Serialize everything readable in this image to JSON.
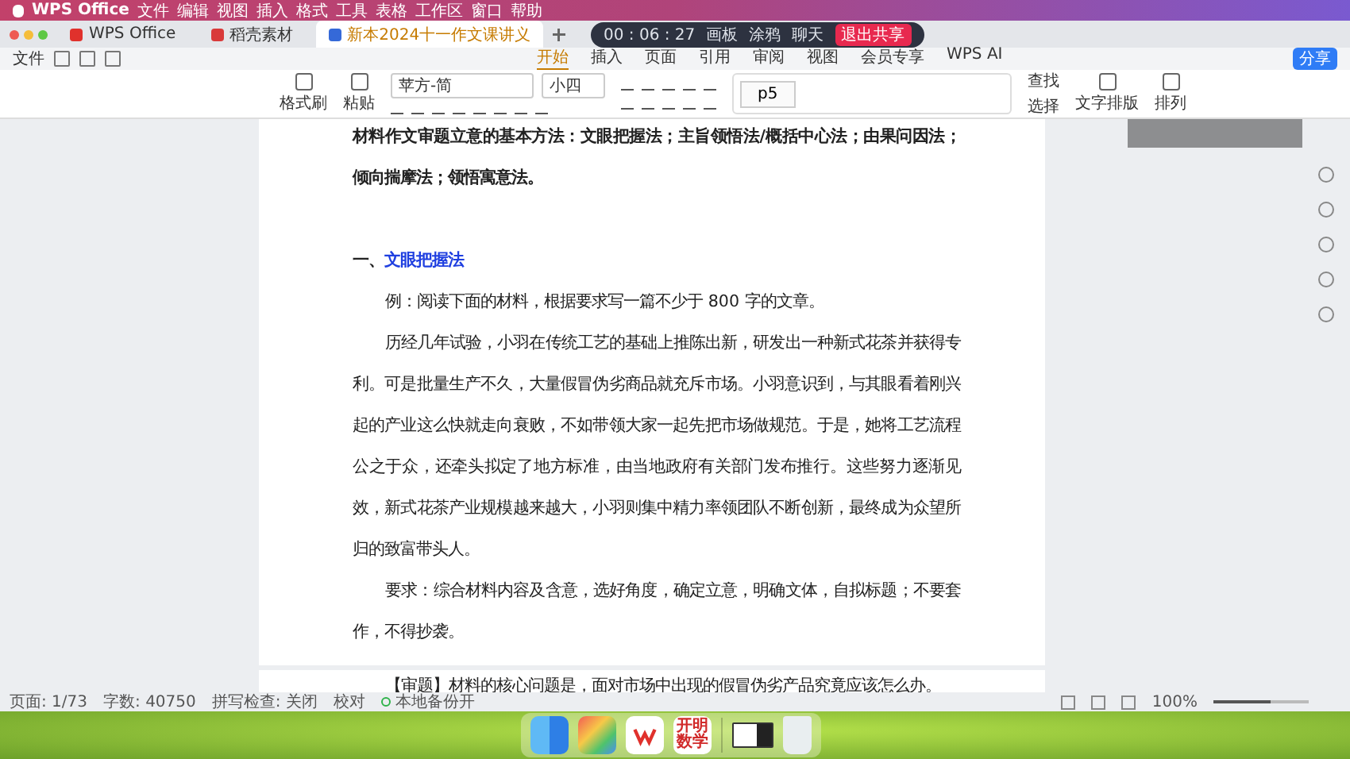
{
  "menu_bar": {
    "app": "WPS Office",
    "items": [
      "文件",
      "编辑",
      "视图",
      "插入",
      "格式",
      "工具",
      "表格",
      "工作区",
      "窗口",
      "帮助"
    ]
  },
  "tabs": [
    {
      "label": "WPS Office",
      "kind": "home",
      "selected": false
    },
    {
      "label": "稻壳素材",
      "kind": "docer",
      "selected": false
    },
    {
      "label": "新本2024十一作文课讲义",
      "kind": "document",
      "selected": true
    }
  ],
  "recording_bar": {
    "timer": "00 : 06 : 27",
    "buttons": [
      "画板",
      "涂鸦",
      "聊天"
    ],
    "exit": "退出共享"
  },
  "quick_access": {
    "file": "文件"
  },
  "ribbon_tabs": [
    {
      "label": "开始",
      "selected": true
    },
    {
      "label": "插入",
      "selected": false
    },
    {
      "label": "页面",
      "selected": false
    },
    {
      "label": "引用",
      "selected": false
    },
    {
      "label": "审阅",
      "selected": false
    },
    {
      "label": "视图",
      "selected": false
    },
    {
      "label": "会员专享",
      "selected": false
    },
    {
      "label": "WPS AI",
      "selected": false
    }
  ],
  "share": "分享",
  "toolbar": {
    "format_painter": "格式刷",
    "paste": "粘贴",
    "font": "苹方-简",
    "size": "小四",
    "style": "p5",
    "find": "查找",
    "select": "选择",
    "text_layout": "文字排版",
    "arrange": "排列"
  },
  "document": {
    "pages": [
      {
        "paragraphs": [
          {
            "kind": "bold",
            "text": "材料作文审题立意的基本方法：文眼把握法；主旨领悟法/概括中心法；由果问因法；倾向揣摩法；领悟寓意法。"
          },
          {
            "kind": "heading",
            "number": "一、",
            "text": "文眼把握法"
          },
          {
            "kind": "body",
            "text": "例：阅读下面的材料，根据要求写一篇不少于 800 字的文章。"
          },
          {
            "kind": "body",
            "text": "历经几年试验，小羽在传统工艺的基础上推陈出新，研发出一种新式花茶并获得专利。可是批量生产不久，大量假冒伪劣商品就充斥市场。小羽意识到，与其眼看着刚兴起的产业这么快就走向衰败，不如带领大家一起先把市场做规范。于是，她将工艺流程公之于众，还牵头拟定了地方标准，由当地政府有关部门发布推行。这些努力逐渐见效，新式花茶产业规模越来越大，小羽则集中精力率领团队不断创新，最终成为众望所归的致富带头人。"
          },
          {
            "kind": "body",
            "text": "要求：综合材料内容及含意，选好角度，确定立意，明确文体，自拟标题；不要套作，不得抄袭。"
          }
        ]
      },
      {
        "paragraphs": [
          {
            "kind": "body",
            "text": "【审题】材料的核心问题是，面对市场中出现的假冒伪劣产品究竟应该怎么办。"
          }
        ]
      }
    ]
  },
  "status_bar": {
    "page": "页面: 1/73",
    "words": "字数: 40750",
    "spell": "拼写检查: 关闭",
    "proof": "校对",
    "backup": "本地备份开",
    "zoom": "100%",
    "zoom_slider": {
      "level": 0.6
    }
  },
  "dock": {
    "app_label": "开明数学"
  }
}
